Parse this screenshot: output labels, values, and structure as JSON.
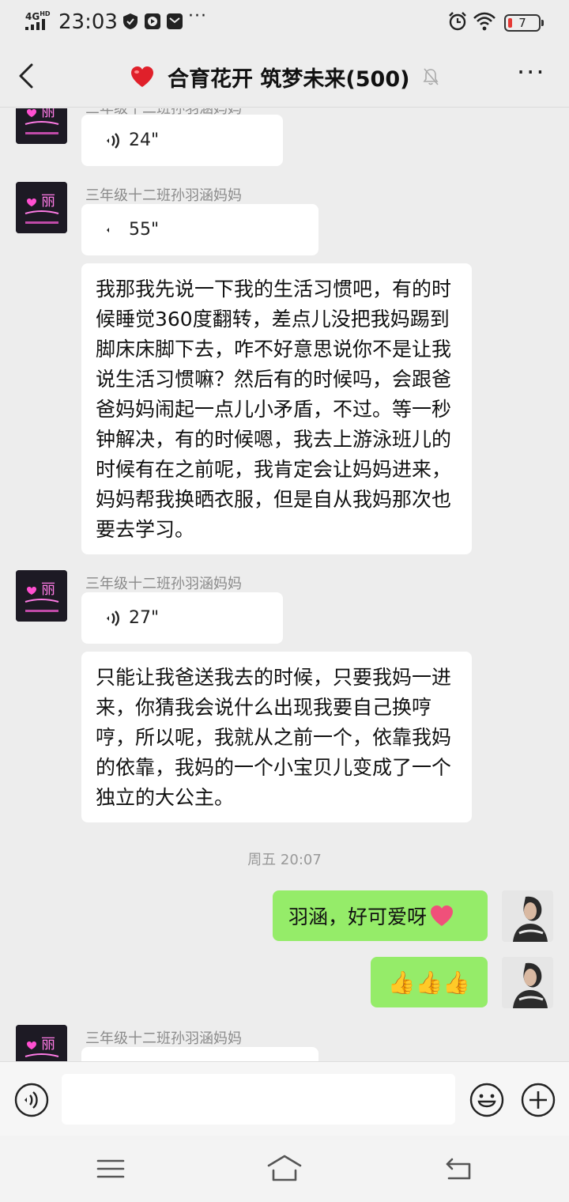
{
  "status_bar": {
    "network": "4G",
    "network_sup": "HD",
    "time": "23:03",
    "battery": "7",
    "icons": [
      "shield-icon",
      "play-icon",
      "mail-icon",
      "more-icon",
      "alarm-icon",
      "wifi-icon",
      "battery-icon"
    ]
  },
  "header": {
    "title": "合育花开 筑梦未来(500)",
    "icons": [
      "back-icon",
      "heart-icon",
      "mute-icon",
      "more-icon"
    ]
  },
  "messages": [
    {
      "type": "voice",
      "sender": "三年级十二班孙羽涵妈妈",
      "duration": "24\""
    },
    {
      "type": "voice",
      "sender": "三年级十二班孙羽涵妈妈",
      "duration": "55\""
    },
    {
      "type": "text",
      "text": "我那我先说一下我的生活习惯吧，有的时候睡觉360度翻转，差点儿没把我妈踢到脚床床脚下去，咋不好意思说你不是让我说生活习惯嘛？然后有的时候吗，会跟爸爸妈妈闹起一点儿小矛盾，不过。等一秒钟解决，有的时候嗯，我去上游泳班儿的时候有在之前呢，我肯定会让妈妈进来，妈妈帮我换晒衣服，但是自从我妈那次也要去学习。"
    },
    {
      "type": "voice",
      "sender": "三年级十二班孙羽涵妈妈",
      "duration": "27\""
    },
    {
      "type": "text",
      "text": "只能让我爸送我去的时候，只要我妈一进来，你猜我会说什么出现我要自己换哼哼，所以呢，我就从之前一个，依靠我妈的依靠，我妈的一个小宝贝儿变成了一个独立的大公主。"
    },
    {
      "type": "timestamp",
      "text": "周五 20:07"
    },
    {
      "type": "self",
      "text": "羽涵，好可爱呀",
      "emoji": "heart-emoji"
    },
    {
      "type": "self",
      "text": "👍👍👍",
      "emoji": "thumbs-up-emoji"
    },
    {
      "type": "voice",
      "sender": "三年级十二班孙羽涵妈妈",
      "duration": ""
    }
  ],
  "avatar": {
    "group_member_text": "丽"
  },
  "input_bar": {
    "placeholder": "",
    "icons": [
      "voice-input-icon",
      "emoji-icon",
      "plus-icon"
    ]
  },
  "nav_bar": {
    "icons": [
      "menu-icon",
      "home-icon",
      "back-nav-icon"
    ]
  },
  "colors": {
    "background": "#ededed",
    "self_bubble": "#95ec69",
    "other_bubble": "#ffffff",
    "sender_text": "#8a8a8a"
  }
}
